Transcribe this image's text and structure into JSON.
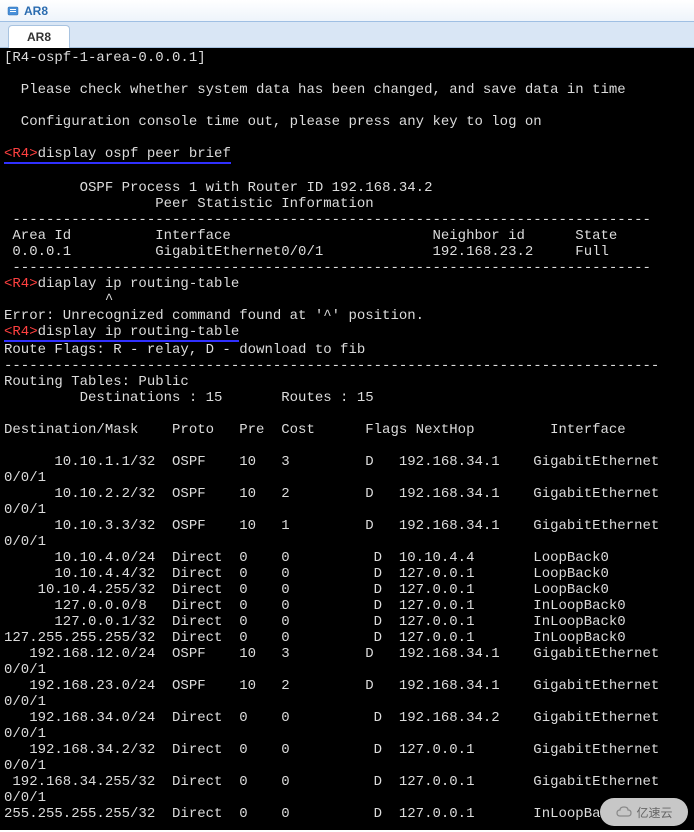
{
  "window": {
    "title": "AR8"
  },
  "tab": {
    "label": "AR8"
  },
  "terminal": {
    "context_line": "[R4-ospf-1-area-0.0.0.1]",
    "warn_save": "  Please check whether system data has been changed, and save data in time",
    "warn_timeout": "  Configuration console time out, please press any key to log on",
    "prompt1": "<R4>",
    "cmd1": "display ospf peer brief",
    "ospf_header1": "\t OSPF Process 1 with Router ID 192.168.34.2",
    "ospf_header2": "\t\t  Peer Statistic Information",
    "dash": " ----------------------------------------------------------------------------",
    "peer_cols": " Area Id          Interface                        Neighbor id      State",
    "peer_row": " 0.0.0.1          GigabitEthernet0/0/1             192.168.23.2     Full",
    "prompt2": "<R4>",
    "cmd2_bad": "diaplay ip routing-table",
    "caret_line": "            ^",
    "error_line": "Error: Unrecognized command found at '^' position.",
    "prompt3": "<R4>",
    "cmd3": "display ip routing-table",
    "route_flags": "Route Flags: R - relay, D - download to fib",
    "dash2": "------------------------------------------------------------------------------",
    "routing_public": "Routing Tables: Public",
    "dest_routes": "         Destinations : 15       Routes : 15",
    "route_cols": "Destination/Mask    Proto   Pre  Cost      Flags NextHop         Interface",
    "routes": [
      {
        "dest": "      10.10.1.1/32",
        "proto": "OSPF",
        "pre": "10",
        "cost": "3",
        "flags": "  D",
        "nexthop": "192.168.34.1",
        "iface": "GigabitEthernet",
        "iface2": "0/0/1"
      },
      {
        "dest": "      10.10.2.2/32",
        "proto": "OSPF",
        "pre": "10",
        "cost": "2",
        "flags": "  D",
        "nexthop": "192.168.34.1",
        "iface": "GigabitEthernet",
        "iface2": "0/0/1"
      },
      {
        "dest": "      10.10.3.3/32",
        "proto": "OSPF",
        "pre": "10",
        "cost": "1",
        "flags": "  D",
        "nexthop": "192.168.34.1",
        "iface": "GigabitEthernet",
        "iface2": "0/0/1"
      },
      {
        "dest": "      10.10.4.0/24",
        "proto": "Direct",
        "pre": "0",
        "cost": "0",
        "flags": "   D",
        "nexthop": "10.10.4.4",
        "iface": "LoopBack0",
        "iface2": ""
      },
      {
        "dest": "      10.10.4.4/32",
        "proto": "Direct",
        "pre": "0",
        "cost": "0",
        "flags": "   D",
        "nexthop": "127.0.0.1",
        "iface": "LoopBack0",
        "iface2": ""
      },
      {
        "dest": "    10.10.4.255/32",
        "proto": "Direct",
        "pre": "0",
        "cost": "0",
        "flags": "   D",
        "nexthop": "127.0.0.1",
        "iface": "LoopBack0",
        "iface2": ""
      },
      {
        "dest": "      127.0.0.0/8",
        "proto": "Direct",
        "pre": "0",
        "cost": "0",
        "flags": "   D",
        "nexthop": "127.0.0.1",
        "iface": "InLoopBack0",
        "iface2": ""
      },
      {
        "dest": "      127.0.0.1/32",
        "proto": "Direct",
        "pre": "0",
        "cost": "0",
        "flags": "   D",
        "nexthop": "127.0.0.1",
        "iface": "InLoopBack0",
        "iface2": ""
      },
      {
        "dest": "127.255.255.255/32",
        "proto": "Direct",
        "pre": "0",
        "cost": "0",
        "flags": "   D",
        "nexthop": "127.0.0.1",
        "iface": "InLoopBack0",
        "iface2": ""
      },
      {
        "dest": "   192.168.12.0/24",
        "proto": "OSPF",
        "pre": "10",
        "cost": "3",
        "flags": "  D",
        "nexthop": "192.168.34.1",
        "iface": "GigabitEthernet",
        "iface2": "0/0/1"
      },
      {
        "dest": "   192.168.23.0/24",
        "proto": "OSPF",
        "pre": "10",
        "cost": "2",
        "flags": "  D",
        "nexthop": "192.168.34.1",
        "iface": "GigabitEthernet",
        "iface2": "0/0/1"
      },
      {
        "dest": "   192.168.34.0/24",
        "proto": "Direct",
        "pre": "0",
        "cost": "0",
        "flags": "   D",
        "nexthop": "192.168.34.2",
        "iface": "GigabitEthernet",
        "iface2": "0/0/1"
      },
      {
        "dest": "   192.168.34.2/32",
        "proto": "Direct",
        "pre": "0",
        "cost": "0",
        "flags": "   D",
        "nexthop": "127.0.0.1",
        "iface": "GigabitEthernet",
        "iface2": "0/0/1"
      },
      {
        "dest": " 192.168.34.255/32",
        "proto": "Direct",
        "pre": "0",
        "cost": "0",
        "flags": "   D",
        "nexthop": "127.0.0.1",
        "iface": "GigabitEthernet",
        "iface2": "0/0/1"
      },
      {
        "dest": "255.255.255.255/32",
        "proto": "Direct",
        "pre": "0",
        "cost": "0",
        "flags": "   D",
        "nexthop": "127.0.0.1",
        "iface": "InLoopBa",
        "iface2": ""
      }
    ]
  },
  "watermark": {
    "text": "亿速云"
  }
}
